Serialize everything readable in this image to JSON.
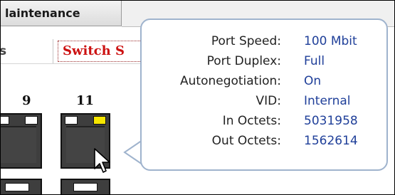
{
  "menubar": {
    "active_tab_label": "laintenance"
  },
  "subbar": {
    "partial_label": "s",
    "switch_tab_label": "Switch S"
  },
  "ports": {
    "labels": [
      "9",
      "11"
    ],
    "led_color": "#f7e600"
  },
  "tooltip": {
    "rows": [
      {
        "label": "Port Speed:",
        "value": "100 Mbit"
      },
      {
        "label": "Port Duplex:",
        "value": "Full"
      },
      {
        "label": "Autonegotiation:",
        "value": "On"
      },
      {
        "label": "VID:",
        "value": "Internal"
      },
      {
        "label": "In Octets:",
        "value": "5031958"
      },
      {
        "label": "Out Octets:",
        "value": "1562614"
      }
    ],
    "border_color": "#9fb3cd",
    "value_color": "#1f3f99"
  },
  "icons": {
    "cursor": "mouse-pointer-icon"
  }
}
